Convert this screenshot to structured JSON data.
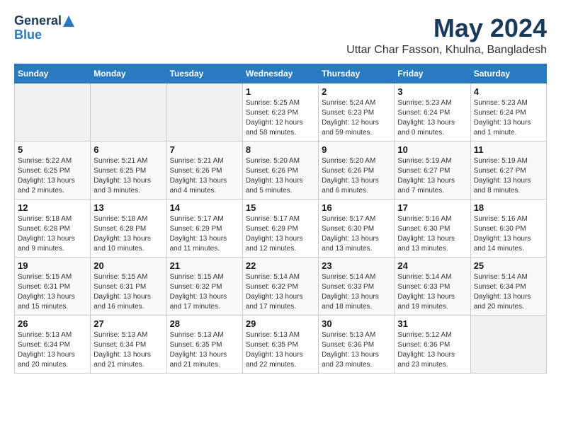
{
  "header": {
    "logo_line1": "General",
    "logo_line2": "Blue",
    "month": "May 2024",
    "location": "Uttar Char Fasson, Khulna, Bangladesh"
  },
  "days_of_week": [
    "Sunday",
    "Monday",
    "Tuesday",
    "Wednesday",
    "Thursday",
    "Friday",
    "Saturday"
  ],
  "weeks": [
    [
      {
        "day": "",
        "info": ""
      },
      {
        "day": "",
        "info": ""
      },
      {
        "day": "",
        "info": ""
      },
      {
        "day": "1",
        "info": "Sunrise: 5:25 AM\nSunset: 6:23 PM\nDaylight: 12 hours and 58 minutes."
      },
      {
        "day": "2",
        "info": "Sunrise: 5:24 AM\nSunset: 6:23 PM\nDaylight: 12 hours and 59 minutes."
      },
      {
        "day": "3",
        "info": "Sunrise: 5:23 AM\nSunset: 6:24 PM\nDaylight: 13 hours and 0 minutes."
      },
      {
        "day": "4",
        "info": "Sunrise: 5:23 AM\nSunset: 6:24 PM\nDaylight: 13 hours and 1 minute."
      }
    ],
    [
      {
        "day": "5",
        "info": "Sunrise: 5:22 AM\nSunset: 6:25 PM\nDaylight: 13 hours and 2 minutes."
      },
      {
        "day": "6",
        "info": "Sunrise: 5:21 AM\nSunset: 6:25 PM\nDaylight: 13 hours and 3 minutes."
      },
      {
        "day": "7",
        "info": "Sunrise: 5:21 AM\nSunset: 6:26 PM\nDaylight: 13 hours and 4 minutes."
      },
      {
        "day": "8",
        "info": "Sunrise: 5:20 AM\nSunset: 6:26 PM\nDaylight: 13 hours and 5 minutes."
      },
      {
        "day": "9",
        "info": "Sunrise: 5:20 AM\nSunset: 6:26 PM\nDaylight: 13 hours and 6 minutes."
      },
      {
        "day": "10",
        "info": "Sunrise: 5:19 AM\nSunset: 6:27 PM\nDaylight: 13 hours and 7 minutes."
      },
      {
        "day": "11",
        "info": "Sunrise: 5:19 AM\nSunset: 6:27 PM\nDaylight: 13 hours and 8 minutes."
      }
    ],
    [
      {
        "day": "12",
        "info": "Sunrise: 5:18 AM\nSunset: 6:28 PM\nDaylight: 13 hours and 9 minutes."
      },
      {
        "day": "13",
        "info": "Sunrise: 5:18 AM\nSunset: 6:28 PM\nDaylight: 13 hours and 10 minutes."
      },
      {
        "day": "14",
        "info": "Sunrise: 5:17 AM\nSunset: 6:29 PM\nDaylight: 13 hours and 11 minutes."
      },
      {
        "day": "15",
        "info": "Sunrise: 5:17 AM\nSunset: 6:29 PM\nDaylight: 13 hours and 12 minutes."
      },
      {
        "day": "16",
        "info": "Sunrise: 5:17 AM\nSunset: 6:30 PM\nDaylight: 13 hours and 13 minutes."
      },
      {
        "day": "17",
        "info": "Sunrise: 5:16 AM\nSunset: 6:30 PM\nDaylight: 13 hours and 13 minutes."
      },
      {
        "day": "18",
        "info": "Sunrise: 5:16 AM\nSunset: 6:30 PM\nDaylight: 13 hours and 14 minutes."
      }
    ],
    [
      {
        "day": "19",
        "info": "Sunrise: 5:15 AM\nSunset: 6:31 PM\nDaylight: 13 hours and 15 minutes."
      },
      {
        "day": "20",
        "info": "Sunrise: 5:15 AM\nSunset: 6:31 PM\nDaylight: 13 hours and 16 minutes."
      },
      {
        "day": "21",
        "info": "Sunrise: 5:15 AM\nSunset: 6:32 PM\nDaylight: 13 hours and 17 minutes."
      },
      {
        "day": "22",
        "info": "Sunrise: 5:14 AM\nSunset: 6:32 PM\nDaylight: 13 hours and 17 minutes."
      },
      {
        "day": "23",
        "info": "Sunrise: 5:14 AM\nSunset: 6:33 PM\nDaylight: 13 hours and 18 minutes."
      },
      {
        "day": "24",
        "info": "Sunrise: 5:14 AM\nSunset: 6:33 PM\nDaylight: 13 hours and 19 minutes."
      },
      {
        "day": "25",
        "info": "Sunrise: 5:14 AM\nSunset: 6:34 PM\nDaylight: 13 hours and 20 minutes."
      }
    ],
    [
      {
        "day": "26",
        "info": "Sunrise: 5:13 AM\nSunset: 6:34 PM\nDaylight: 13 hours and 20 minutes."
      },
      {
        "day": "27",
        "info": "Sunrise: 5:13 AM\nSunset: 6:34 PM\nDaylight: 13 hours and 21 minutes."
      },
      {
        "day": "28",
        "info": "Sunrise: 5:13 AM\nSunset: 6:35 PM\nDaylight: 13 hours and 21 minutes."
      },
      {
        "day": "29",
        "info": "Sunrise: 5:13 AM\nSunset: 6:35 PM\nDaylight: 13 hours and 22 minutes."
      },
      {
        "day": "30",
        "info": "Sunrise: 5:13 AM\nSunset: 6:36 PM\nDaylight: 13 hours and 23 minutes."
      },
      {
        "day": "31",
        "info": "Sunrise: 5:12 AM\nSunset: 6:36 PM\nDaylight: 13 hours and 23 minutes."
      },
      {
        "day": "",
        "info": ""
      }
    ]
  ]
}
